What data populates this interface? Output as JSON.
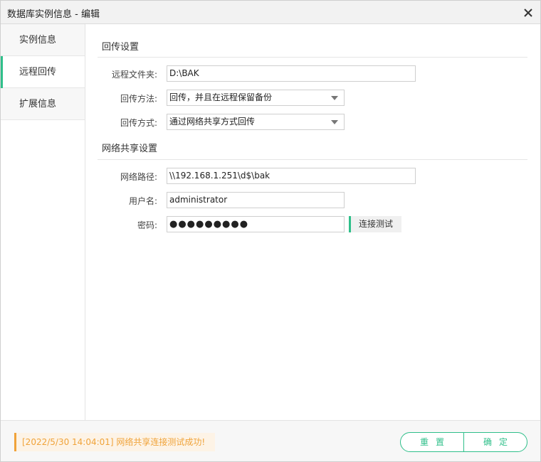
{
  "window": {
    "title": "数据库实例信息 - 编辑"
  },
  "sidebar": {
    "items": [
      {
        "label": "实例信息"
      },
      {
        "label": "远程回传"
      },
      {
        "label": "扩展信息"
      }
    ],
    "active_index": 1
  },
  "return_settings": {
    "section_title": "回传设置",
    "remote_folder": {
      "label": "远程文件夹:",
      "value": "D:\\BAK"
    },
    "return_method": {
      "label": "回传方法:",
      "value": "回传，并且在远程保留备份"
    },
    "return_mode": {
      "label": "回传方式:",
      "value": "通过网络共享方式回传"
    }
  },
  "network_share": {
    "section_title": "网络共享设置",
    "path": {
      "label": "网络路径:",
      "value": "\\\\192.168.1.251\\d$\\bak"
    },
    "username": {
      "label": "用户名:",
      "value": "administrator"
    },
    "password": {
      "label": "密码:",
      "value": "●●●●●●●●●"
    },
    "test_button": "连接测试"
  },
  "footer": {
    "status": "[2022/5/30  14:04:01] 网络共享连接测试成功!",
    "reset_button": "重置",
    "ok_button": "确定"
  },
  "colors": {
    "accent": "#2fbf8a",
    "status": "#f0a33a"
  }
}
